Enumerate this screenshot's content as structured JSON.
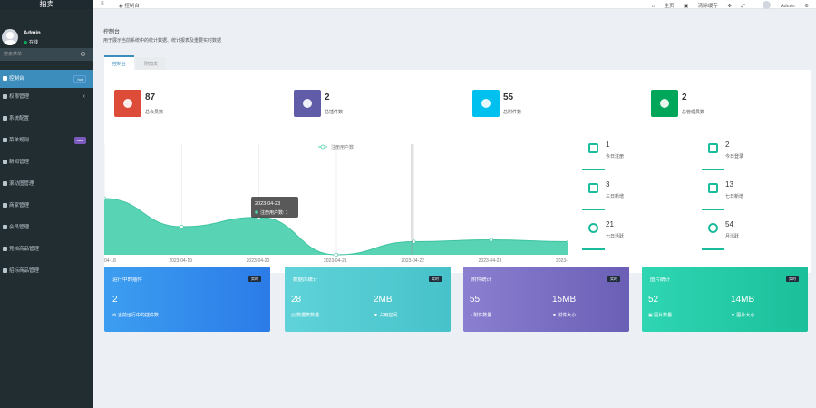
{
  "sidebar": {
    "brand": "拍卖",
    "user": {
      "name": "Admin",
      "status": "在线"
    },
    "search_placeholder": "搜索菜单",
    "items": [
      {
        "label": "控制台",
        "badge": "hot"
      },
      {
        "label": "权限管理"
      },
      {
        "label": "系统配置"
      },
      {
        "label": "菜单规则",
        "badge": "new"
      },
      {
        "label": "新闻管理"
      },
      {
        "label": "滚动图管理"
      },
      {
        "label": "商家管理"
      },
      {
        "label": "会员管理"
      },
      {
        "label": "竞拍商品管理"
      },
      {
        "label": "招标商品管理"
      }
    ]
  },
  "header": {
    "tab": "控制台",
    "home": "主页",
    "clear_cache": "清除缓存",
    "user": "Admin"
  },
  "page": {
    "title": "控制台",
    "subtitle": "用于展示当前系统中的统计数据、统计报表及重要实时数据",
    "tabs": [
      "控制台",
      "附加文"
    ]
  },
  "stats": [
    {
      "value": "87",
      "label": "总会员数",
      "color": "#dd4b39"
    },
    {
      "value": "2",
      "label": "总插件数",
      "color": "#605ca8"
    },
    {
      "value": "55",
      "label": "总附件数",
      "color": "#00c0ef"
    },
    {
      "value": "2",
      "label": "总管理员数",
      "color": "#00a65a"
    }
  ],
  "chart_data": {
    "type": "area",
    "series": [
      {
        "name": "注册用户数",
        "values": [
          3,
          1.5,
          2,
          0,
          0.7,
          0.8,
          0.7
        ]
      }
    ],
    "x": [
      "04-18",
      "2023-04-19",
      "2023-04-20",
      "2023-04-21",
      "2023-04-22",
      "2023-04-23",
      "2023-0"
    ],
    "tooltip": {
      "date": "2023-04-23",
      "text": "注册用户数: 1"
    },
    "color": "#4fd1b0",
    "grid": true,
    "legend": "top-center"
  },
  "mini_stats": [
    {
      "value": "1",
      "label": "今日注册"
    },
    {
      "value": "2",
      "label": "今日登录"
    },
    {
      "value": "3",
      "label": "三日新增"
    },
    {
      "value": "13",
      "label": "七日新增"
    },
    {
      "value": "21",
      "label": "七日活跃"
    },
    {
      "value": "54",
      "label": "月活跃"
    }
  ],
  "cards": [
    {
      "title": "运行中的插件",
      "badge": "实时",
      "v1": "2",
      "l1": "当前运行中的插件数",
      "color_a": "#3c9ef0",
      "color_b": "#2b7be8"
    },
    {
      "title": "数据库统计",
      "badge": "实时",
      "v1": "28",
      "l1": "数据表数量",
      "v2": "2MB",
      "l2": "占用空间",
      "color_a": "#5fd3d9",
      "color_b": "#47c2c9"
    },
    {
      "title": "附件统计",
      "badge": "实时",
      "v1": "55",
      "l1": "附件数量",
      "v2": "15MB",
      "l2": "附件大小",
      "color_a": "#8a7fd0",
      "color_b": "#6a5fb5"
    },
    {
      "title": "图片统计",
      "badge": "实时",
      "v1": "52",
      "l1": "图片数量",
      "v2": "14MB",
      "l2": "图片大小",
      "color_a": "#2fd6b3",
      "color_b": "#1bbf9a"
    }
  ]
}
